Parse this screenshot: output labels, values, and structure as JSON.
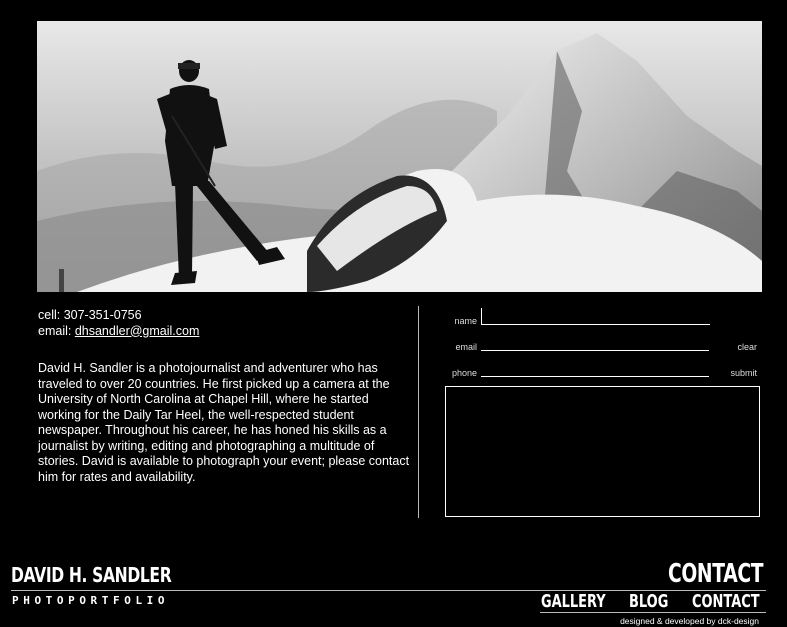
{
  "contact": {
    "cell": "cell: 307-351-0756",
    "email_prefix": "email: ",
    "email": "dhsandler@gmail.com"
  },
  "bio": "David H. Sandler is a photojournalist and adventurer who has traveled to over 20 countries. He first picked up a camera at the University of North Carolina at Chapel Hill, where he started working for the Daily Tar Heel, the well-respected student newspaper. Throughout his career, he has honed his skills as a journalist by writing, editing and photographing a multitude of stories. David is available to photograph your event; please contact him for rates and availability.",
  "form": {
    "name_label": "name",
    "email_label": "email",
    "phone_label": "phone",
    "clear_label": "clear",
    "submit_label": "submit"
  },
  "branding": {
    "name": "DAVID H. SANDLER",
    "subtitle": "PHOTOPORTFOLIO"
  },
  "page_heading": "CONTACT",
  "nav": {
    "gallery": "GALLERY",
    "blog": "BLOG",
    "contact": "CONTACT"
  },
  "credit": "designed & developed by dck-design"
}
